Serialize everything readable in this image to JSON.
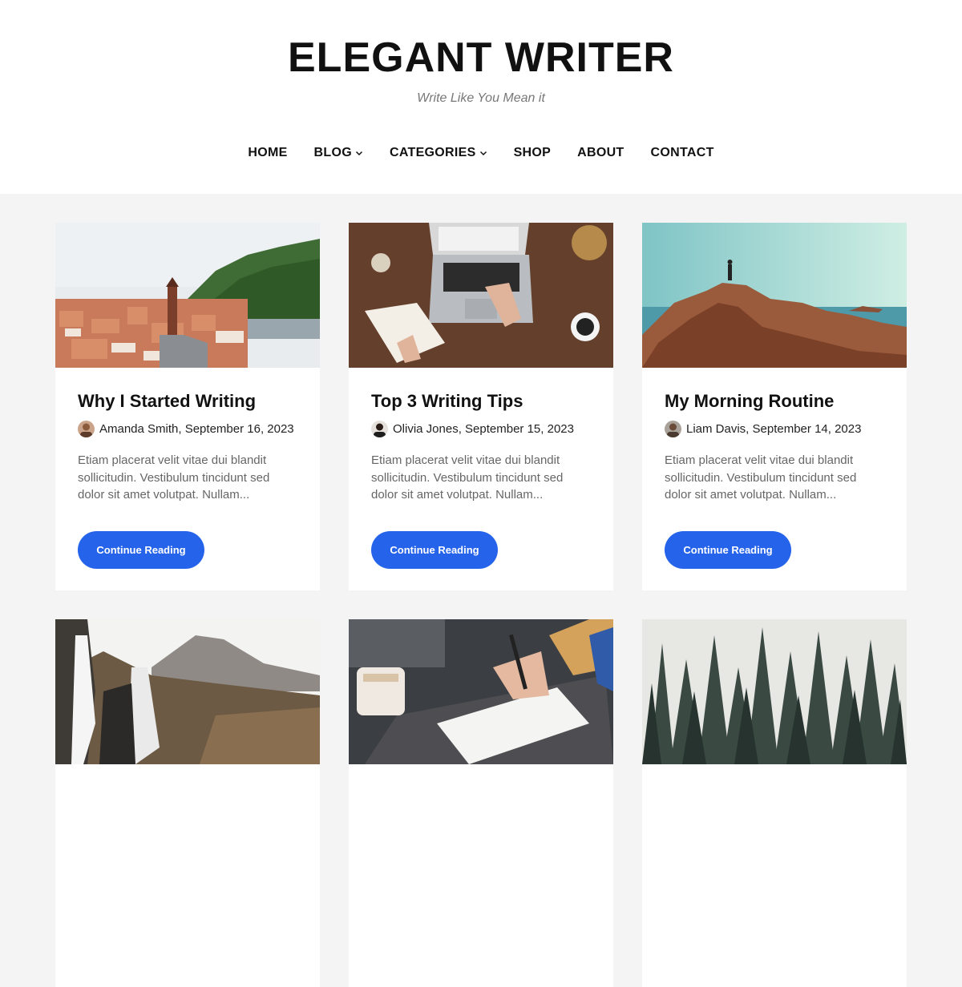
{
  "site": {
    "title": "ELEGANT WRITER",
    "tagline": "Write Like You Mean it"
  },
  "nav": {
    "items": [
      {
        "label": "HOME",
        "dropdown": false
      },
      {
        "label": "BLOG",
        "dropdown": true
      },
      {
        "label": "CATEGORIES",
        "dropdown": true
      },
      {
        "label": "SHOP",
        "dropdown": false
      },
      {
        "label": "ABOUT",
        "dropdown": false
      },
      {
        "label": "CONTACT",
        "dropdown": false
      }
    ]
  },
  "posts": [
    {
      "title": "Why I Started Writing",
      "meta": "Amanda Smith, September 16, 2023",
      "excerpt": "Etiam placerat velit vitae dui blandit sollicitudin. Vestibulum tincidunt sed dolor sit amet volutpat. Nullam...",
      "button": "Continue Reading",
      "image": "city-hillside-photo"
    },
    {
      "title": "Top 3 Writing Tips",
      "meta": "Olivia Jones, September 15, 2023",
      "excerpt": "Etiam placerat velit vitae dui blandit sollicitudin. Vestibulum tincidunt sed dolor sit amet volutpat. Nullam...",
      "button": "Continue Reading",
      "image": "laptop-desk-photo"
    },
    {
      "title": "My Morning Routine",
      "meta": "Liam Davis, September 14, 2023",
      "excerpt": "Etiam placerat velit vitae dui blandit sollicitudin. Vestibulum tincidunt sed dolor sit amet volutpat. Nullam...",
      "button": "Continue Reading",
      "image": "rock-cliff-sea-photo"
    },
    {
      "image": "waterfall-mountain-photo"
    },
    {
      "image": "writing-notebook-coffee-photo"
    },
    {
      "image": "pine-forest-photo"
    }
  ],
  "colors": {
    "accent": "#2563eb",
    "page_bg": "#f4f4f4",
    "card_bg": "#ffffff",
    "text": "#111111",
    "muted": "#666666"
  }
}
